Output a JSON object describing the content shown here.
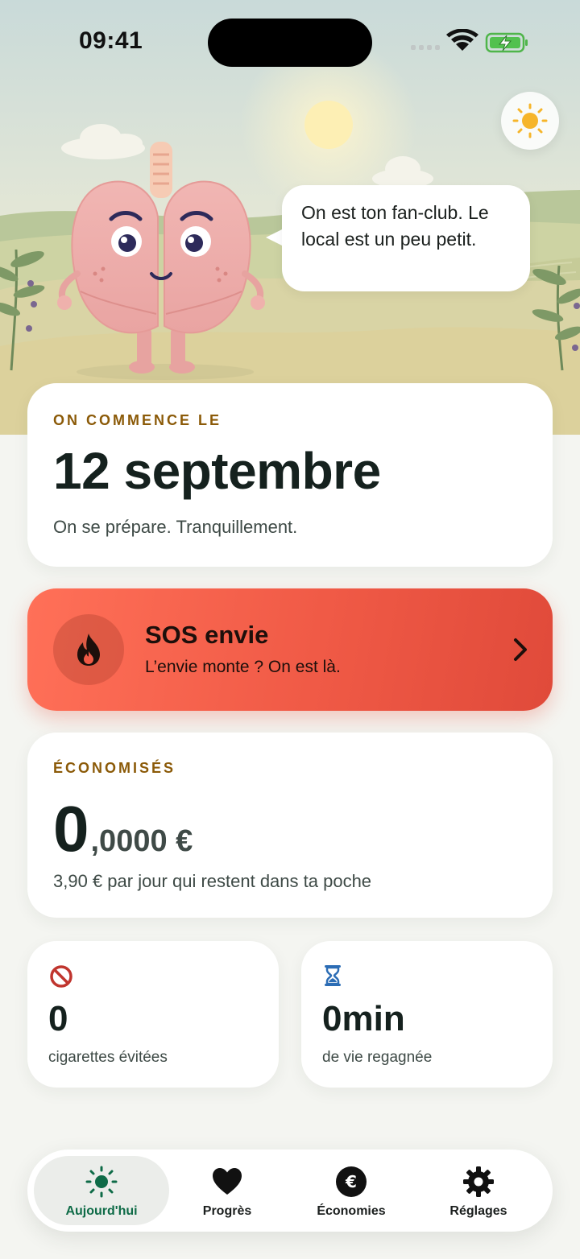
{
  "status_bar": {
    "time": "09:41"
  },
  "hero": {
    "speech_bubble": "On est ton fan-club. Le local est un peu petit.",
    "weather_icon": "sun-icon",
    "mascot": "lungs-character"
  },
  "start_card": {
    "eyebrow": "ON COMMENCE LE",
    "date": "12 septembre",
    "subtitle": "On se prépare. Tranquillement."
  },
  "sos": {
    "title": "SOS envie",
    "subtitle": "L’envie monte ? On est là.",
    "icon": "flame-icon",
    "color": "#f05a46"
  },
  "savings": {
    "eyebrow": "ÉCONOMISÉS",
    "amount_integer": "0",
    "amount_decimal": ",0000 €",
    "subtitle": "3,90 € par jour qui restent dans ta poche"
  },
  "stats": [
    {
      "icon": "no-smoking-icon",
      "value": "0",
      "label": "cigarettes évitées"
    },
    {
      "icon": "hourglass-icon",
      "value": "0min",
      "label": "de vie regagnée"
    }
  ],
  "tabbar": {
    "accent": "#0e6b47",
    "items": [
      {
        "label": "Aujourd'hui",
        "icon": "sun-icon",
        "active": true
      },
      {
        "label": "Progrès",
        "icon": "heart-icon",
        "active": false
      },
      {
        "label": "Économies",
        "icon": "euro-icon",
        "active": false
      },
      {
        "label": "Réglages",
        "icon": "gear-icon",
        "active": false
      }
    ]
  }
}
